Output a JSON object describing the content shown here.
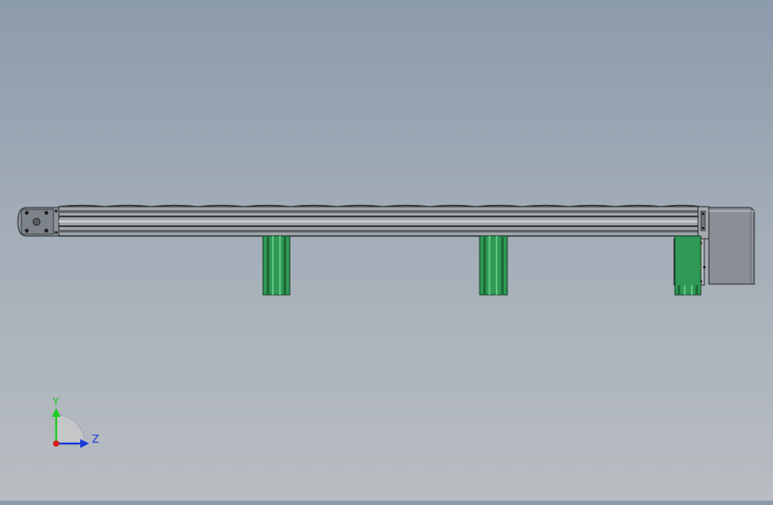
{
  "viewport": {
    "background_top": "#8c9bab",
    "background_bottom": "#b9bdc2"
  },
  "model": {
    "rail_color": "#9ea4aa",
    "rail_dark": "#3a3d40",
    "support_color": "#2f9a55",
    "support_dark": "#1e6a38",
    "motor_color": "#8a8e96",
    "plate_color": "#b5b8bc"
  },
  "triad": {
    "y_label": "Y",
    "z_label": "Z",
    "y_color": "#22cc22",
    "z_color": "#1a3ad8",
    "x_color": "#d81a1a"
  }
}
